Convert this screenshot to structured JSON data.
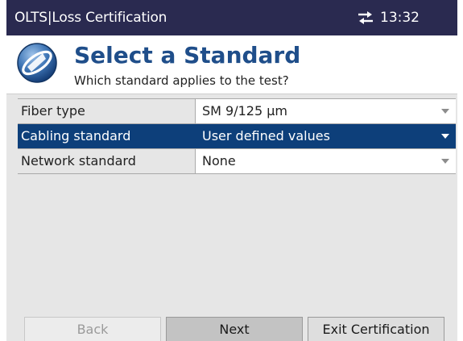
{
  "statusbar": {
    "title": "OLTS|Loss Certification",
    "network_icon": "network-transfer-icon",
    "time": "13:32"
  },
  "header": {
    "logo_icon": "globe-compass-icon",
    "title": "Select a Standard",
    "subtitle": "Which standard applies to the test?"
  },
  "settings": [
    {
      "label": "Fiber type",
      "value": "SM 9/125 µm",
      "selected": false
    },
    {
      "label": "Cabling standard",
      "value": "User defined values",
      "selected": true
    },
    {
      "label": "Network standard",
      "value": "None",
      "selected": false
    }
  ],
  "buttons": {
    "back": "Back",
    "next": "Next",
    "exit": "Exit Certification"
  },
  "colors": {
    "statusbar_bg": "#2a2a50",
    "title_text": "#1f4e8a",
    "selection_bg": "#0d3f7a",
    "panel_bg": "#e6e6e6"
  }
}
